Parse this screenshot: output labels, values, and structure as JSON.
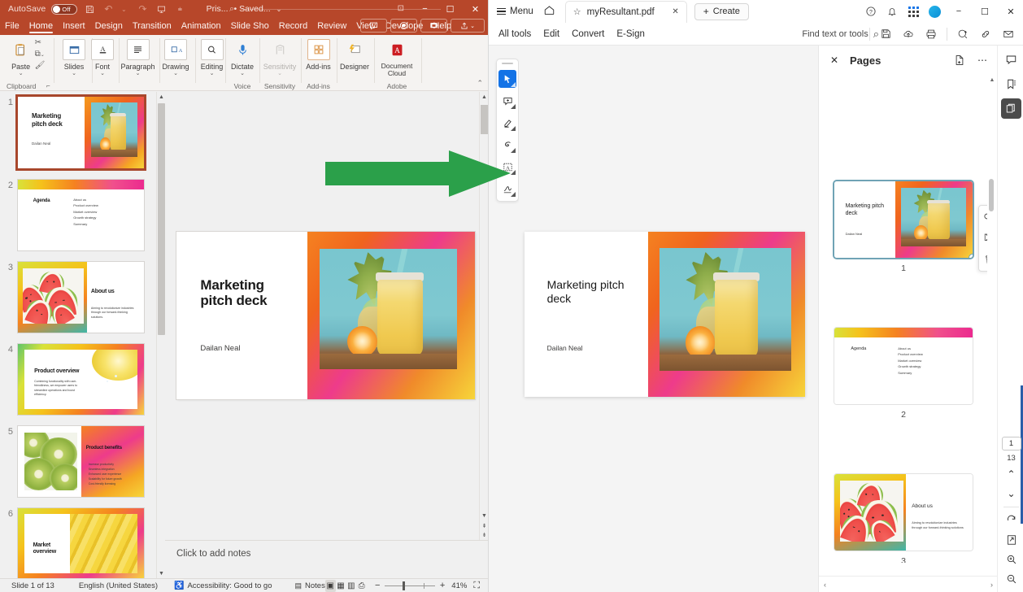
{
  "powerpoint": {
    "titlebar": {
      "autosave_label": "AutoSave",
      "autosave_state": "Off",
      "file_name": "Pris...",
      "saved_status": "• Saved...",
      "icons": [
        "save-icon",
        "undo-icon",
        "redo-icon",
        "present-icon",
        "more-commands-icon"
      ],
      "window_buttons": [
        "minimize",
        "maximize",
        "close"
      ]
    },
    "tabs": [
      {
        "label": "File",
        "active": false
      },
      {
        "label": "Home",
        "active": true
      },
      {
        "label": "Insert",
        "active": false
      },
      {
        "label": "Design",
        "active": false
      },
      {
        "label": "Transition",
        "active": false
      },
      {
        "label": "Animation",
        "active": false
      },
      {
        "label": "Slide Sho",
        "active": false
      },
      {
        "label": "Record",
        "active": false
      },
      {
        "label": "Review",
        "active": false
      },
      {
        "label": "View",
        "active": false
      },
      {
        "label": "Develope",
        "active": false
      },
      {
        "label": "Help",
        "active": false
      }
    ],
    "tab_buttons": [
      "comments-button",
      "record-button",
      "present-button",
      "share-button"
    ],
    "ribbon": {
      "groups": [
        {
          "name": "Clipboard",
          "label": "Clipboard",
          "buttons": [
            {
              "label": "Paste",
              "icon": "paste-icon",
              "caret": "⌄"
            },
            {
              "label": "",
              "icon": "cut-icon",
              "caret": ""
            },
            {
              "label": "",
              "icon": "copy-icon",
              "caret": "⌄"
            },
            {
              "label": "",
              "icon": "format-painter-icon",
              "caret": ""
            }
          ]
        },
        {
          "name": "Slides",
          "label": "",
          "buttons": [
            {
              "label": "Slides",
              "icon": "slides-icon",
              "caret": "⌄"
            }
          ]
        },
        {
          "name": "Font",
          "label": "",
          "buttons": [
            {
              "label": "Font",
              "icon": "font-icon",
              "caret": "⌄"
            }
          ]
        },
        {
          "name": "Paragraph",
          "label": "",
          "buttons": [
            {
              "label": "Paragraph",
              "icon": "paragraph-icon",
              "caret": "⌄"
            }
          ]
        },
        {
          "name": "Drawing",
          "label": "",
          "buttons": [
            {
              "label": "Drawing",
              "icon": "drawing-icon",
              "caret": "⌄"
            }
          ]
        },
        {
          "name": "Editing",
          "label": "",
          "buttons": [
            {
              "label": "Editing",
              "icon": "editing-icon",
              "caret": "⌄"
            }
          ]
        },
        {
          "name": "Voice",
          "label": "Voice",
          "buttons": [
            {
              "label": "Dictate",
              "icon": "microphone-icon",
              "caret": "⌄"
            }
          ]
        },
        {
          "name": "Sensitivity",
          "label": "Sensitivity",
          "buttons": [
            {
              "label": "Sensitivity",
              "icon": "sensitivity-icon",
              "caret": "⌄",
              "disabled": true
            }
          ]
        },
        {
          "name": "Add-ins",
          "label": "Add-ins",
          "buttons": [
            {
              "label": "Add-ins",
              "icon": "addins-icon",
              "caret": ""
            }
          ]
        },
        {
          "name": "Designer",
          "label": "",
          "buttons": [
            {
              "label": "Designer",
              "icon": "designer-icon",
              "caret": ""
            }
          ]
        },
        {
          "name": "Adobe",
          "label": "Adobe",
          "buttons": [
            {
              "label": "Document Cloud",
              "icon": "adobe-icon",
              "caret": ""
            }
          ]
        }
      ],
      "collapse_icon": "⌃"
    },
    "slides": [
      {
        "number": "1",
        "title": "Marketing pitch deck",
        "subtitle": "Dailan Neal",
        "layout": "title-photo-right",
        "selected": true
      },
      {
        "number": "2",
        "title": "Agenda",
        "layout": "agenda",
        "bullets": [
          "About us",
          "Product overview",
          "Market overview",
          "Growth strategy",
          "Summary"
        ]
      },
      {
        "number": "3",
        "title": "About us",
        "layout": "photo-left",
        "body": "Aiming to revolutionize industries through our forward-thinking solutions."
      },
      {
        "number": "4",
        "title": "Product overview",
        "layout": "lemon-top-right",
        "body": "Combining functionality with user-friendliness, we empower users to streamline operations and boost efficiency."
      },
      {
        "number": "5",
        "title": "Product benefits",
        "layout": "kiwi-left",
        "bullets": [
          "Increase productivity",
          "Seamless integration",
          "Enhanced user experience",
          "Scalability for future growth",
          "Cost-friendly licensing"
        ]
      },
      {
        "number": "6",
        "title": "Market overview",
        "layout": "banana-right"
      }
    ],
    "editor": {
      "current_slide_title": "Marketing pitch deck",
      "current_slide_subtitle": "Dailan Neal"
    },
    "notes": {
      "placeholder": "Click to add notes"
    },
    "status_bar": {
      "slide_counter": "Slide 1 of 13",
      "language": "English (United States)",
      "accessibility": "Accessibility: Good to go",
      "notes_label": "Notes",
      "views": [
        "normal-view",
        "slide-sorter-view",
        "reading-view",
        "slideshow-view"
      ],
      "zoom_minus": "−",
      "zoom_plus": "+",
      "zoom_level": "41%",
      "fit_icon": "fit-slide-icon"
    }
  },
  "acrobat": {
    "topbar": {
      "menu_label": "Menu",
      "home_icon": "home-icon",
      "tab_title": "myResultant.pdf",
      "tab_star_icon": "star-icon",
      "tab_close_icon": "close-icon",
      "create_label": "Create",
      "create_plus": "+",
      "icons": [
        "help-icon",
        "bell-icon",
        "apps-grid-icon",
        "avatar"
      ],
      "window_buttons": [
        "minimize",
        "maximize",
        "close"
      ]
    },
    "toolbar": {
      "links": [
        "All tools",
        "Edit",
        "Convert",
        "E-Sign"
      ],
      "find_placeholder": "Find text or tools",
      "find_icon": "search-icon",
      "right_icons": [
        "save-icon",
        "cloud-upload-icon",
        "print-icon",
        "add-comment-icon",
        "link-icon",
        "email-icon"
      ]
    },
    "left_tools": [
      {
        "icon": "select-cursor-icon",
        "active": true
      },
      {
        "icon": "add-comment-icon",
        "active": false
      },
      {
        "icon": "highlight-icon",
        "active": false
      },
      {
        "icon": "draw-freehand-icon",
        "active": false
      },
      {
        "icon": "add-text-box-icon",
        "active": false
      },
      {
        "icon": "signature-icon",
        "active": false
      }
    ],
    "document": {
      "page_title": "Marketing pitch deck",
      "page_author": "Dailan Neal"
    },
    "pages_panel": {
      "title": "Pages",
      "close_icon": "close-icon",
      "insert_page_icon": "insert-page-icon",
      "more_icon": "more-options-icon",
      "thumbnails": [
        {
          "number": "1",
          "title": "Marketing pitch deck",
          "subtitle": "Dailan Neal",
          "selected": true
        },
        {
          "number": "2",
          "title": "Agenda",
          "bullets": [
            "About us",
            "Product overview",
            "Market overview",
            "Growth strategy",
            "Summary"
          ]
        },
        {
          "number": "3",
          "title": "About us",
          "body": "Aiming to revolutionize industries through our forward-thinking solutions"
        }
      ]
    },
    "right_rail": {
      "buttons": [
        {
          "icon": "comments-icon",
          "active": false
        },
        {
          "icon": "bookmarks-icon",
          "active": false
        },
        {
          "icon": "page-thumbnails-icon",
          "active": true
        }
      ],
      "current_page": "1",
      "total_pages": "13",
      "prev_icon": "chevron-up-icon",
      "next_icon": "chevron-down-icon",
      "rotate_icon": "rotate-icon",
      "fit_icon": "fit-page-icon",
      "zoom_in_icon": "zoom-in-icon",
      "zoom_out_icon": "zoom-out-icon"
    }
  },
  "annotation": {
    "arrow": {
      "name": "green-arrow",
      "color": "#2ba04a",
      "direction": "right"
    }
  },
  "theme": {
    "ppt_accent": "#b7472a",
    "acrobat_accent": "#1473e6",
    "arrow_green": "#2ba04a"
  }
}
